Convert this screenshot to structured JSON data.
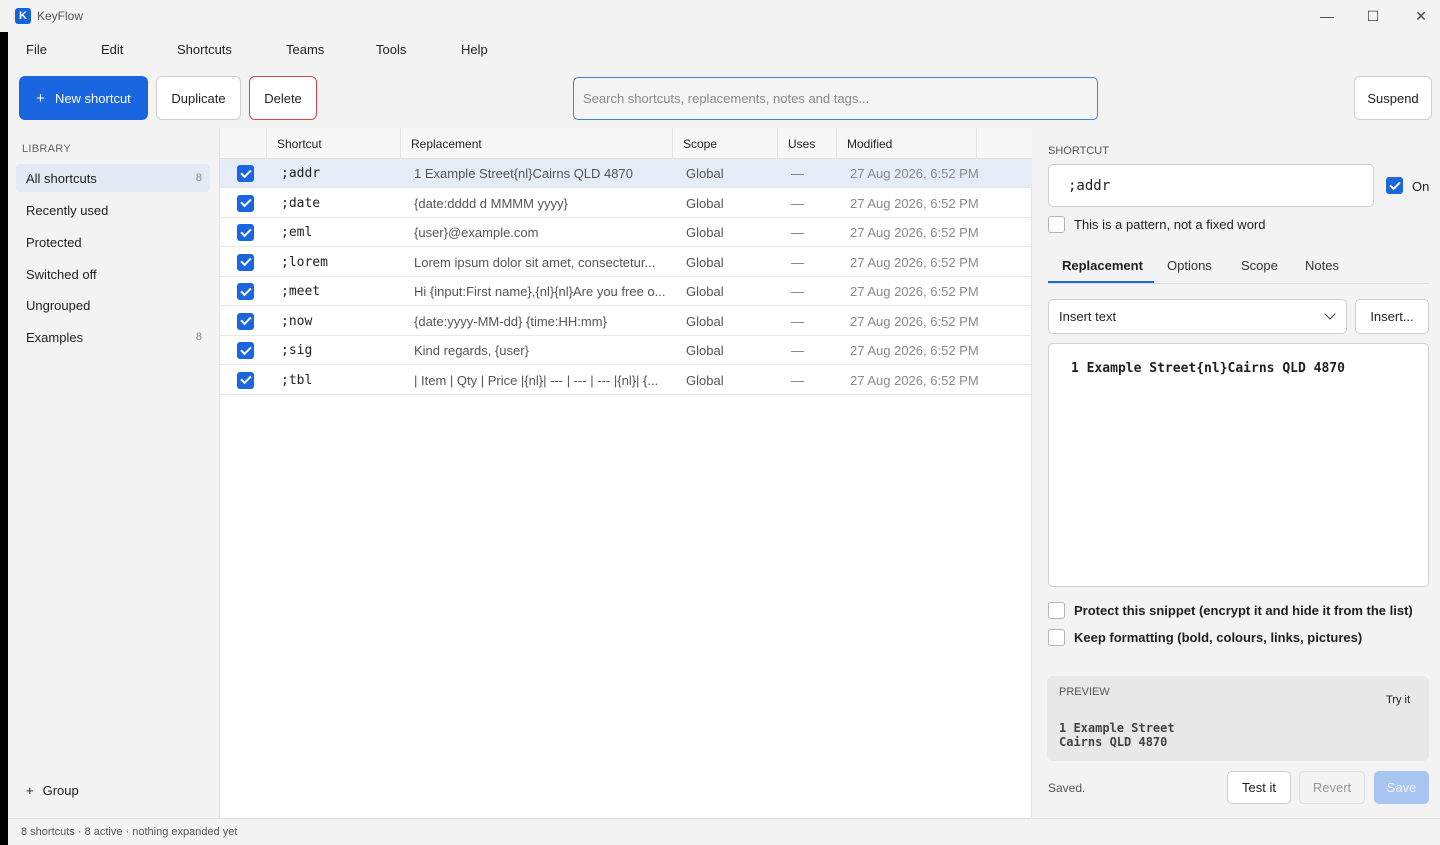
{
  "window": {
    "title": "KeyFlow",
    "logo_letter": "K",
    "minimize": "—",
    "maximize": "☐",
    "close": "✕"
  },
  "menu": [
    "File",
    "Edit",
    "Shortcuts",
    "Teams",
    "Tools",
    "Help"
  ],
  "toolbar": {
    "new_label": "New shortcut",
    "new_icon": "+",
    "duplicate_label": "Duplicate",
    "delete_label": "Delete",
    "search_placeholder": "Search shortcuts, replacements, notes and tags...",
    "search_value": "",
    "suspend_label": "Suspend"
  },
  "sidebar": {
    "title": "LIBRARY",
    "items": [
      {
        "label": "All shortcuts",
        "count": "8",
        "active": true
      },
      {
        "label": "Recently used",
        "count": ""
      },
      {
        "label": "Protected",
        "count": ""
      },
      {
        "label": "Switched off",
        "count": ""
      },
      {
        "label": "Ungrouped",
        "count": ""
      },
      {
        "label": "Examples",
        "count": "8"
      }
    ],
    "group_icon": "+",
    "group_label": "Group"
  },
  "table": {
    "columns": [
      "Shortcut",
      "Replacement",
      "Scope",
      "Uses",
      "Modified"
    ],
    "rows": [
      {
        "checked": true,
        "shortcut": ";addr",
        "replacement": "1 Example Street{nl}Cairns QLD 4870",
        "scope": "Global",
        "uses": "—",
        "modified": "27 Aug 2026, 6:52 PM",
        "selected": true
      },
      {
        "checked": true,
        "shortcut": ";date",
        "replacement": "{date:dddd d MMMM yyyy}",
        "scope": "Global",
        "uses": "—",
        "modified": "27 Aug 2026, 6:52 PM"
      },
      {
        "checked": true,
        "shortcut": ";eml",
        "replacement": "{user}@example.com",
        "scope": "Global",
        "uses": "—",
        "modified": "27 Aug 2026, 6:52 PM"
      },
      {
        "checked": true,
        "shortcut": ";lorem",
        "replacement": "Lorem ipsum dolor sit amet, consectetur...",
        "scope": "Global",
        "uses": "—",
        "modified": "27 Aug 2026, 6:52 PM"
      },
      {
        "checked": true,
        "shortcut": ";meet",
        "replacement": "Hi {input:First name},{nl}{nl}Are you free o...",
        "scope": "Global",
        "uses": "—",
        "modified": "27 Aug 2026, 6:52 PM"
      },
      {
        "checked": true,
        "shortcut": ";now",
        "replacement": "{date:yyyy-MM-dd} {time:HH:mm}",
        "scope": "Global",
        "uses": "—",
        "modified": "27 Aug 2026, 6:52 PM"
      },
      {
        "checked": true,
        "shortcut": ";sig",
        "replacement": "Kind regards, {user}",
        "scope": "Global",
        "uses": "—",
        "modified": "27 Aug 2026, 6:52 PM"
      },
      {
        "checked": true,
        "shortcut": ";tbl",
        "replacement": "| Item | Qty | Price |{nl}| --- | --- | --- |{nl}| {...",
        "scope": "Global",
        "uses": "—",
        "modified": "27 Aug 2026, 6:52 PM"
      }
    ]
  },
  "detail": {
    "section_label": "SHORTCUT",
    "shortcut_value": ";addr",
    "on_label": "On",
    "on_checked": true,
    "pattern_label": "This is a pattern, not a fixed word",
    "pattern_checked": false,
    "tabs": [
      "Replacement",
      "Options",
      "Scope",
      "Notes"
    ],
    "active_tab": "Replacement",
    "insert_mode": "Insert text",
    "insert_button": "Insert...",
    "editor_text": "1 Example Street{nl}Cairns QLD 4870",
    "protect_label": "Protect this snippet (encrypt it and hide it from the list)",
    "format_label": "Keep formatting (bold, colours, links, pictures)",
    "preview_label": "PREVIEW",
    "try_it": "Try it",
    "preview_text": "1 Example Street\nCairns QLD 4870",
    "status": "Saved.",
    "test_label": "Test it",
    "revert_label": "Revert",
    "save_label": "Save"
  },
  "statusbar": {
    "text": "8 shortcuts · 8 active · nothing expanded yet"
  },
  "colors": {
    "accent": "#1a66e0",
    "danger": "#d04848",
    "selected_row": "#e5ecf8"
  }
}
